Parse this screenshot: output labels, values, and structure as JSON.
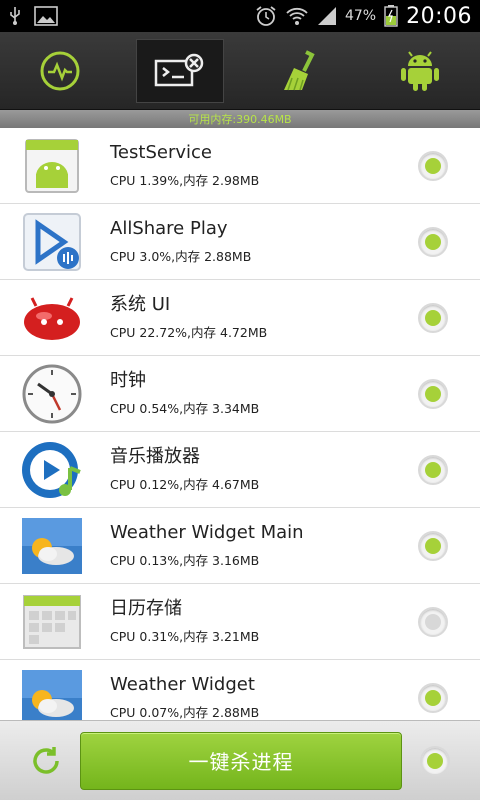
{
  "status_bar": {
    "battery": "47%",
    "time": "20:06",
    "icons": [
      "usb-icon",
      "image-icon",
      "alarm-icon",
      "wifi-icon",
      "signal-icon",
      "battery-icon"
    ]
  },
  "toolbar": {
    "tabs": [
      "monitor-icon",
      "task-kill-icon",
      "broom-icon",
      "android-icon"
    ],
    "active_tab": 1
  },
  "memory": {
    "text": "可用内存:390.46MB"
  },
  "processes": [
    {
      "name": "TestService",
      "stats": "CPU 1.39%,内存 2.98MB",
      "icon": "test-service-icon",
      "selected": true
    },
    {
      "name": "AllShare Play",
      "stats": "CPU 3.0%,内存 2.88MB",
      "icon": "allshare-play-icon",
      "selected": true
    },
    {
      "name": "系统 UI",
      "stats": "CPU 22.72%,内存 4.72MB",
      "icon": "jellybean-icon",
      "selected": true
    },
    {
      "name": "时钟",
      "stats": "CPU 0.54%,内存 3.34MB",
      "icon": "clock-icon",
      "selected": true
    },
    {
      "name": "音乐播放器",
      "stats": "CPU 0.12%,内存 4.67MB",
      "icon": "music-player-icon",
      "selected": true
    },
    {
      "name": "Weather Widget Main",
      "stats": "CPU 0.13%,内存 3.16MB",
      "icon": "weather-icon",
      "selected": true
    },
    {
      "name": "日历存储",
      "stats": "CPU 0.31%,内存 3.21MB",
      "icon": "calendar-storage-icon",
      "selected": false
    },
    {
      "name": "Weather Widget",
      "stats": "CPU 0.07%,内存 2.88MB",
      "icon": "weather-icon",
      "selected": true
    }
  ],
  "bottom": {
    "kill_label": "一键杀进程",
    "select_all": true
  },
  "colors": {
    "accent": "#a6d139",
    "button": "#86c42a"
  }
}
